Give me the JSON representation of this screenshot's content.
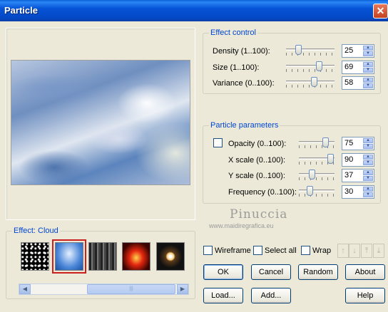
{
  "window": {
    "title": "Particle",
    "close_glyph": "✕"
  },
  "effect_control": {
    "title": "Effect control",
    "rows": [
      {
        "label": "Density (1..100):",
        "value": "25",
        "slider_fraction": 0.25
      },
      {
        "label": "Size (1..100):",
        "value": "69",
        "slider_fraction": 0.69
      },
      {
        "label": "Variance (0..100):",
        "value": "58",
        "slider_fraction": 0.58
      }
    ]
  },
  "particle_parameters": {
    "title": "Particle parameters",
    "rows": [
      {
        "label": "Opacity (0..100):",
        "value": "75",
        "slider_fraction": 0.75
      },
      {
        "label": "X scale (0..100):",
        "value": "90",
        "slider_fraction": 0.9
      },
      {
        "label": "Y scale (0..100):",
        "value": "37",
        "slider_fraction": 0.37
      },
      {
        "label": "Frequency (0..100):",
        "value": "30",
        "slider_fraction": 0.3
      }
    ]
  },
  "effect_group": {
    "title": "Effect: Cloud"
  },
  "options": {
    "wireframe": "Wireframe",
    "select_all": "Select all",
    "wrap": "Wrap"
  },
  "buttons": {
    "ok": "OK",
    "cancel": "Cancel",
    "random": "Random",
    "about": "About",
    "load": "Load...",
    "add": "Add...",
    "help": "Help"
  },
  "arrows": {
    "up": "↑",
    "down": "↓",
    "top": "⤒",
    "bottom": "⤓"
  },
  "scroll": {
    "left": "◀",
    "right": "▶",
    "grip": "|||"
  },
  "watermark": {
    "name": "Pinuccia",
    "url": "www.maidiregrafica.eu"
  },
  "spin_glyphs": {
    "up": "▲",
    "down": "▼"
  }
}
